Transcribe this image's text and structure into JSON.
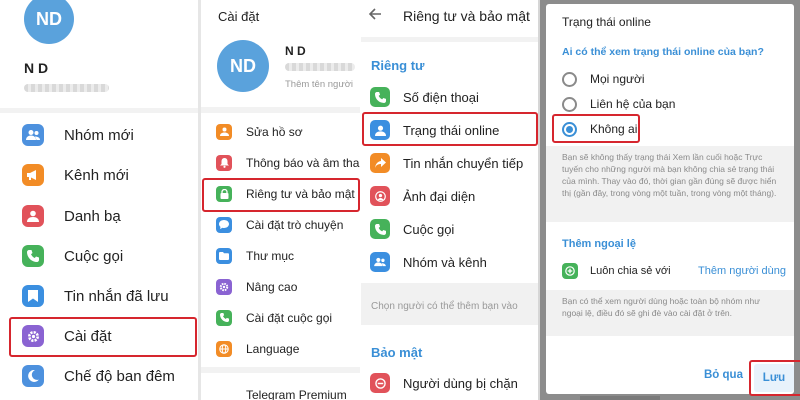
{
  "panel1": {
    "avatar_initials": "ND",
    "user_name": "N D",
    "menu": [
      {
        "label": "Nhóm mới",
        "icon": "group-icon",
        "color": "#4d91de"
      },
      {
        "label": "Kênh mới",
        "icon": "megaphone-icon",
        "color": "#f28c26"
      },
      {
        "label": "Danh bạ",
        "icon": "contact-icon",
        "color": "#e1525a"
      },
      {
        "label": "Cuộc gọi",
        "icon": "phone-icon",
        "color": "#46b25a"
      },
      {
        "label": "Tin nhắn đã lưu",
        "icon": "bookmark-icon",
        "color": "#3b8fe0"
      },
      {
        "label": "Cài đặt",
        "icon": "gear-icon",
        "color": "#8a63d2"
      },
      {
        "label": "Chế độ ban đêm",
        "icon": "moon-icon",
        "color": "#4d91de"
      }
    ]
  },
  "panel2": {
    "title": "Cài đặt",
    "avatar_initials": "ND",
    "user_name": "N D",
    "add_username_hint": "Thêm tên người",
    "menu": [
      {
        "label": "Sửa hồ sơ",
        "icon": "edit-profile-icon",
        "color": "#f28c26"
      },
      {
        "label": "Thông báo và âm thanh",
        "icon": "bell-icon",
        "color": "#e1525a"
      },
      {
        "label": "Riêng tư và bảo mật",
        "icon": "lock-icon",
        "color": "#46b25a"
      },
      {
        "label": "Cài đặt trò chuyện",
        "icon": "chat-bubble-icon",
        "color": "#3b8fe0"
      },
      {
        "label": "Thư mục",
        "icon": "folder-icon",
        "color": "#3b8fe0"
      },
      {
        "label": "Nâng cao",
        "icon": "advanced-icon",
        "color": "#8a63d2"
      },
      {
        "label": "Cài đặt cuộc gọi",
        "icon": "phone-icon",
        "color": "#46b25a"
      },
      {
        "label": "Language",
        "icon": "globe-icon",
        "color": "#f28c26"
      }
    ],
    "premium_label": "Telegram Premium"
  },
  "panel3": {
    "title": "Riêng tư và bảo mật",
    "privacy_section": "Riêng tư",
    "menu": [
      {
        "label": "Số điện thoại",
        "icon": "phone-icon",
        "color": "#46b25a"
      },
      {
        "label": "Trạng thái online",
        "icon": "person-status-icon",
        "color": "#3b8fe0"
      },
      {
        "label": "Tin nhắn chuyển tiếp",
        "icon": "forward-icon",
        "color": "#f28c26"
      },
      {
        "label": "Ảnh đại diện",
        "icon": "profile-photo-icon",
        "color": "#e1525a"
      },
      {
        "label": "Cuộc gọi",
        "icon": "phone-icon",
        "color": "#46b25a"
      },
      {
        "label": "Nhóm và kênh",
        "icon": "group-icon",
        "color": "#3b8fe0"
      }
    ],
    "groups_hint": "Chọn người có thể thêm bạn vào",
    "security_section": "Bảo mật",
    "blocked_label": "Người dùng bị chặn"
  },
  "panel4": {
    "dialog_title": "Trạng thái online",
    "question": "Ai có thể xem trạng thái online của bạn?",
    "options": [
      "Mọi người",
      "Liên hệ của bạn",
      "Không ai"
    ],
    "selected_option": "Không ai",
    "info_text": "Bạn sẽ không thấy trạng thái Xem lần cuối hoặc Trực tuyến cho những người mà bạn không chia sẻ trạng thái của mình. Thay vào đó, thời gian gần đúng sẽ được hiển thị (gần đây, trong vòng một tuần, trong vòng một tháng).",
    "exceptions_title": "Thêm ngoại lệ",
    "always_share_label": "Luôn chia sẻ với",
    "add_users_label": "Thêm người dùng",
    "exceptions_note": "Bạn có thể xem người dùng hoặc toàn bộ nhóm như ngoại lệ, điều đó sẽ ghi đè vào cài đặt ở trên.",
    "skip_button": "Bỏ qua",
    "save_button": "Lưu"
  },
  "colors": {
    "accent": "#3a8fd6",
    "highlight": "#d6262e"
  }
}
